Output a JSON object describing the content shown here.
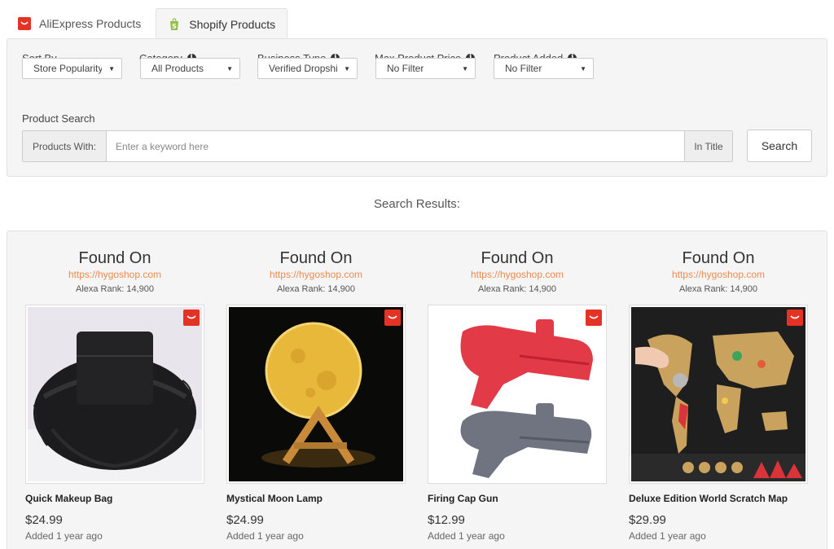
{
  "tabs": [
    {
      "label": "AliExpress Products",
      "active": false
    },
    {
      "label": "Shopify Products",
      "active": true
    }
  ],
  "filters": {
    "sort_by": {
      "label": "Sort By",
      "value": "Store Popularity"
    },
    "category": {
      "label": "Category",
      "value": "All Products"
    },
    "business_type": {
      "label": "Business Type",
      "value": "Verified Dropshipper"
    },
    "max_price": {
      "label": "Max Product Price",
      "value": "No Filter"
    },
    "product_added": {
      "label": "Product Added",
      "value": "No Filter"
    }
  },
  "search": {
    "label": "Product Search",
    "prefix": "Products With:",
    "placeholder": "Enter a keyword here",
    "suffix": "In Title",
    "button_label": "Search"
  },
  "results_title": "Search Results:",
  "products": [
    {
      "found_on": "Found On",
      "site": "https://hygoshop.com",
      "alexa": "Alexa Rank: 14,900",
      "name": "Quick Makeup Bag",
      "price": "$24.99",
      "added": "Added 1 year ago"
    },
    {
      "found_on": "Found On",
      "site": "https://hygoshop.com",
      "alexa": "Alexa Rank: 14,900",
      "name": "Mystical Moon Lamp",
      "price": "$24.99",
      "added": "Added 1 year ago"
    },
    {
      "found_on": "Found On",
      "site": "https://hygoshop.com",
      "alexa": "Alexa Rank: 14,900",
      "name": "Firing Cap Gun",
      "price": "$12.99",
      "added": "Added 1 year ago"
    },
    {
      "found_on": "Found On",
      "site": "https://hygoshop.com",
      "alexa": "Alexa Rank: 14,900",
      "name": "Deluxe Edition World Scratch Map",
      "price": "$29.99",
      "added": "Added 1 year ago"
    }
  ],
  "colors": {
    "accent_link": "#f08a4b",
    "aliexpress_red": "#e43225",
    "shopify_green": "#95bf47"
  },
  "icons": {
    "aliexpress": "aliexpress-logo-icon",
    "shopify": "shopify-bag-icon",
    "info": "info-circle-icon",
    "caret": "caret-down-icon"
  }
}
